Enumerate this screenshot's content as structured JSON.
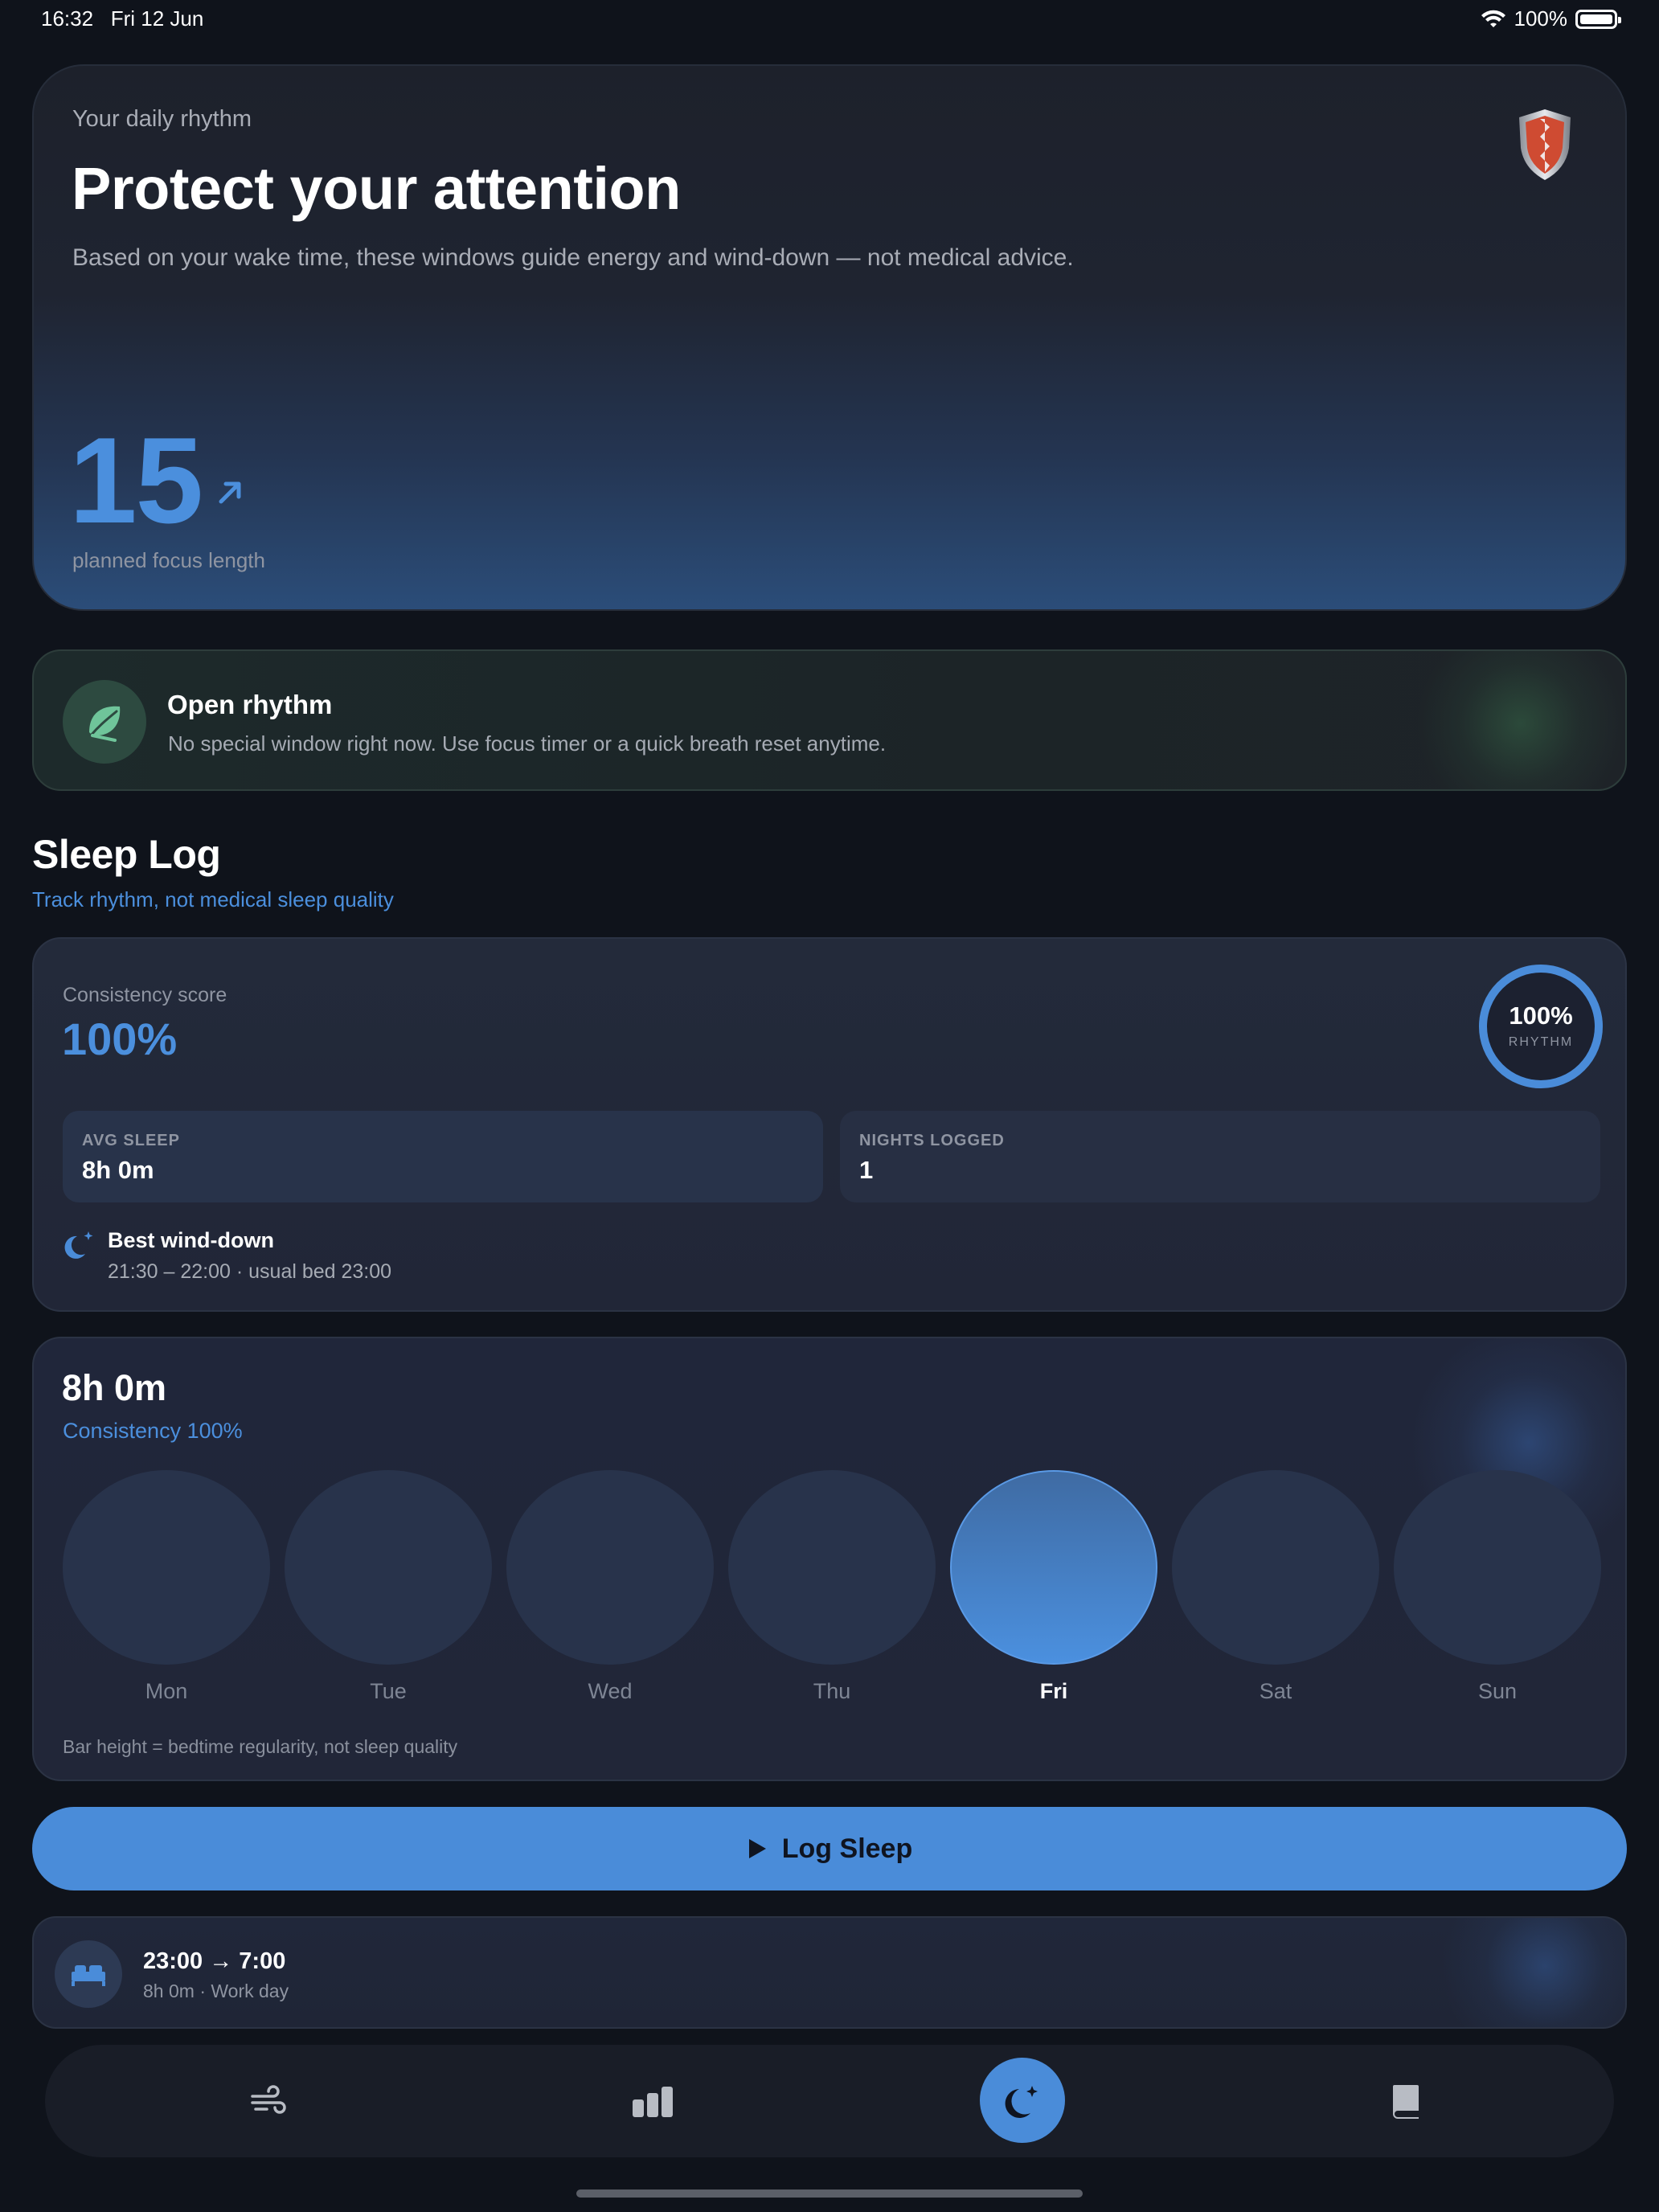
{
  "status_bar": {
    "time": "16:32",
    "date": "Fri 12 Jun",
    "battery": "100%"
  },
  "hero": {
    "overline": "Your daily rhythm",
    "title": "Protect your attention",
    "description": "Based on your wake time, these windows guide energy and wind-down — not medical advice.",
    "focus_value": "15",
    "focus_label": "planned focus length"
  },
  "rhythm_card": {
    "title": "Open rhythm",
    "description": "No special window right now. Use focus timer or a quick breath reset anytime."
  },
  "sleep_log": {
    "title": "Sleep Log",
    "subtitle": "Track rhythm, not medical sleep quality"
  },
  "consistency": {
    "label": "Consistency score",
    "value": "100%",
    "ring_value": "100%",
    "ring_fraction": 1.0,
    "ring_label": "RHYTHM",
    "stats": [
      {
        "label": "AVG SLEEP",
        "value": "8h 0m"
      },
      {
        "label": "NIGHTS LOGGED",
        "value": "1"
      }
    ],
    "wind_down": {
      "title": "Best wind-down",
      "detail": "21:30 – 22:00 · usual bed 23:00"
    }
  },
  "week": {
    "hours": "8h 0m",
    "consistency": "Consistency 100%",
    "days": [
      {
        "label": "Mon",
        "active": false
      },
      {
        "label": "Tue",
        "active": false
      },
      {
        "label": "Wed",
        "active": false
      },
      {
        "label": "Thu",
        "active": false
      },
      {
        "label": "Fri",
        "active": true
      },
      {
        "label": "Sat",
        "active": false
      },
      {
        "label": "Sun",
        "active": false
      }
    ],
    "note": "Bar height = bedtime regularity, not sleep quality"
  },
  "log_button": {
    "label": "Log Sleep"
  },
  "entry": {
    "time": "23:00 → 7:00",
    "detail": "8h 0m · Work day"
  },
  "tabbar": {
    "tabs": [
      {
        "icon": "wind-icon",
        "active": false
      },
      {
        "icon": "stats-icon",
        "active": false
      },
      {
        "icon": "moon-icon",
        "active": true
      },
      {
        "icon": "journal-icon",
        "active": false
      }
    ]
  },
  "colors": {
    "accent": "#4a8cd9",
    "background": "#0f131b",
    "leaf": "#6fc59a"
  }
}
